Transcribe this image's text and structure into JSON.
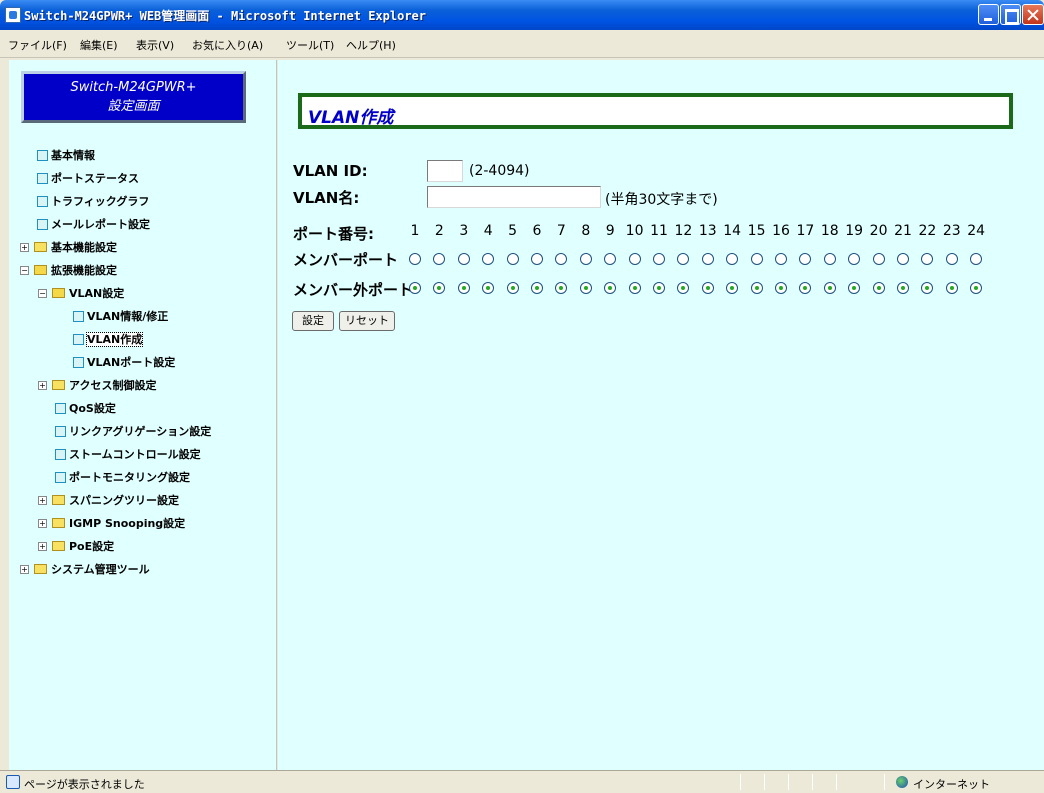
{
  "window": {
    "title": "Switch-M24GPWR+ WEB管理画面 - Microsoft Internet Explorer"
  },
  "menu": {
    "items": [
      "ファイル(F)",
      "編集(E)",
      "表示(V)",
      "お気に入り(A)",
      "ツール(T)",
      "ヘルプ(H)"
    ]
  },
  "sidebar": {
    "header_line1": "Switch-M24GPWR+",
    "header_line2": "設定画面",
    "items": [
      {
        "label": "基本情報",
        "type": "doc"
      },
      {
        "label": "ポートステータス",
        "type": "doc"
      },
      {
        "label": "トラフィックグラフ",
        "type": "doc"
      },
      {
        "label": "メールレポート設定",
        "type": "doc"
      },
      {
        "label": "基本機能設定",
        "type": "folder",
        "state": "collapsed"
      },
      {
        "label": "拡張機能設定",
        "type": "folder",
        "state": "expanded"
      },
      {
        "label": "VLAN設定",
        "type": "folder",
        "state": "expanded"
      },
      {
        "label": "VLAN情報/修正",
        "type": "doc"
      },
      {
        "label": "VLAN作成",
        "type": "doc",
        "selected": true
      },
      {
        "label": "VLANポート設定",
        "type": "doc"
      },
      {
        "label": "アクセス制御設定",
        "type": "folder",
        "state": "collapsed"
      },
      {
        "label": "QoS設定",
        "type": "doc"
      },
      {
        "label": "リンクアグリゲーション設定",
        "type": "doc"
      },
      {
        "label": "ストームコントロール設定",
        "type": "doc"
      },
      {
        "label": "ポートモニタリング設定",
        "type": "doc"
      },
      {
        "label": "スパニングツリー設定",
        "type": "folder",
        "state": "collapsed"
      },
      {
        "label": "IGMP Snooping設定",
        "type": "folder",
        "state": "collapsed"
      },
      {
        "label": "PoE設定",
        "type": "folder",
        "state": "collapsed"
      },
      {
        "label": "システム管理ツール",
        "type": "folder",
        "state": "collapsed"
      }
    ]
  },
  "main": {
    "header": "VLAN作成",
    "vlan_id_label": "VLAN ID:",
    "vlan_id_value": "",
    "vlan_id_hint": "(2-4094)",
    "vlan_name_label": "VLAN名:",
    "vlan_name_value": "",
    "vlan_name_hint": "(半角30文字まで)",
    "port_label": "ポート番号:",
    "ports": [
      "1",
      "2",
      "3",
      "4",
      "5",
      "6",
      "7",
      "8",
      "9",
      "10",
      "11",
      "12",
      "13",
      "14",
      "15",
      "16",
      "17",
      "18",
      "19",
      "20",
      "21",
      "22",
      "23",
      "24"
    ],
    "member_label": "メンバーポート",
    "nonmember_label": "メンバー外ポート",
    "member_selected": [
      false,
      false,
      false,
      false,
      false,
      false,
      false,
      false,
      false,
      false,
      false,
      false,
      false,
      false,
      false,
      false,
      false,
      false,
      false,
      false,
      false,
      false,
      false,
      false
    ],
    "nonmember_selected": [
      true,
      true,
      true,
      true,
      true,
      true,
      true,
      true,
      true,
      true,
      true,
      true,
      true,
      true,
      true,
      true,
      true,
      true,
      true,
      true,
      true,
      true,
      true,
      true
    ],
    "set_button": "設定",
    "reset_button": "リセット"
  },
  "statusbar": {
    "text": "ページが表示されました",
    "zone": "インターネット"
  }
}
